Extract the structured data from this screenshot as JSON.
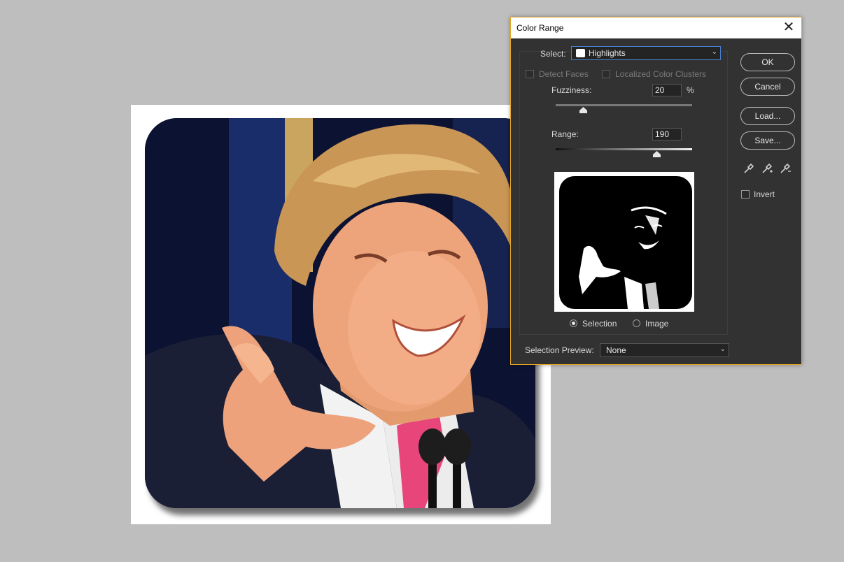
{
  "dialog": {
    "title": "Color Range",
    "select_label": "Select:",
    "select_value": "Highlights",
    "detect_faces_label": "Detect Faces",
    "localized_clusters_label": "Localized Color Clusters",
    "fuzziness_label": "Fuzziness:",
    "fuzziness_value": "20",
    "fuzziness_unit": "%",
    "fuzziness_slider_fraction": 0.2,
    "range_label": "Range:",
    "range_value": "190",
    "range_slider_fraction": 0.74,
    "view_mode": {
      "selection_label": "Selection",
      "image_label": "Image",
      "selected": "Selection"
    },
    "selection_preview_label": "Selection Preview:",
    "selection_preview_value": "None",
    "buttons": {
      "ok": "OK",
      "cancel": "Cancel",
      "load": "Load...",
      "save": "Save..."
    },
    "invert_label": "Invert",
    "invert_checked": false,
    "eyedroppers": [
      "eyedropper-icon",
      "eyedropper-plus-icon",
      "eyedropper-minus-icon"
    ]
  },
  "colors": {
    "dialog_bg": "#323232",
    "dialog_border": "#e8a825",
    "workspace_bg": "#bebebe",
    "select_focus": "#4a7fd1"
  }
}
